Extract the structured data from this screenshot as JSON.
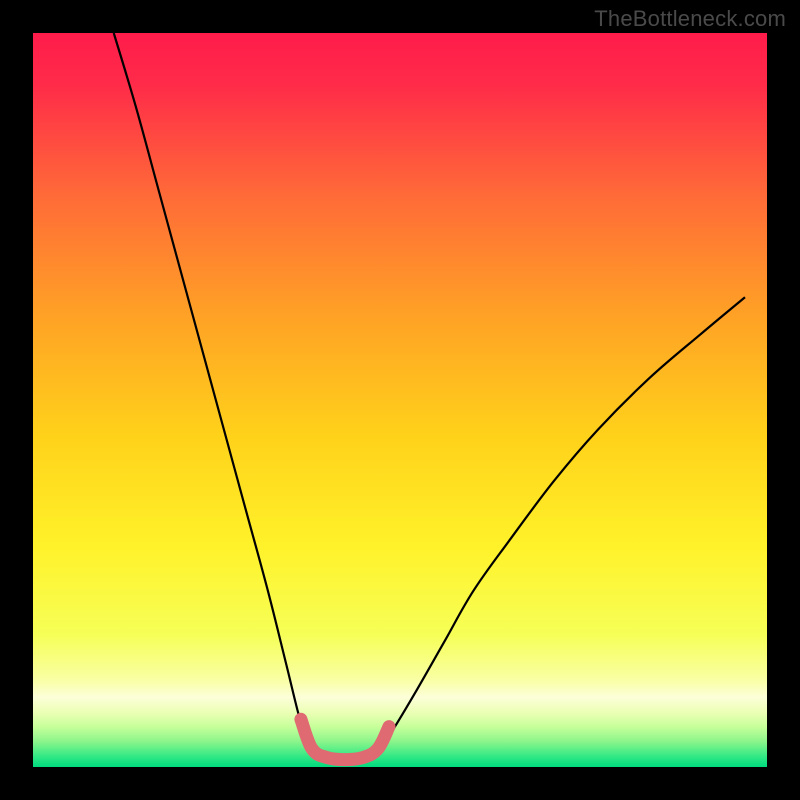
{
  "watermark": "TheBottleneck.com",
  "chart_data": {
    "type": "line",
    "title": "",
    "xlabel": "",
    "ylabel": "",
    "xlim": [
      0,
      100
    ],
    "ylim": [
      0,
      100
    ],
    "grid": false,
    "legend": false,
    "annotations": [],
    "background_gradient": {
      "top": "#ff1c4b",
      "mid_upper": "#ff8a2a",
      "mid": "#ffe600",
      "mid_lower": "#f7ff66",
      "near_bottom": "#d4ff8a",
      "bottom": "#00e37a"
    },
    "series": [
      {
        "name": "left-arm",
        "stroke": "#000000",
        "stroke_width": 2.2,
        "x": [
          11,
          14,
          17,
          20,
          23,
          26,
          29,
          32,
          34.5,
          36.5,
          38
        ],
        "y": [
          100,
          90,
          79,
          68,
          57,
          46,
          35,
          24,
          14,
          6,
          2
        ]
      },
      {
        "name": "right-arm",
        "stroke": "#000000",
        "stroke_width": 2.2,
        "x": [
          47,
          49,
          52,
          56,
          60,
          65,
          71,
          77,
          84,
          91,
          97
        ],
        "y": [
          2,
          5,
          10,
          17,
          24,
          31,
          39,
          46,
          53,
          59,
          64
        ]
      },
      {
        "name": "valley-highlight",
        "stroke": "#e06a72",
        "stroke_width": 13,
        "linecap": "round",
        "x": [
          36.5,
          38,
          40,
          42.5,
          45,
          47,
          48.5
        ],
        "y": [
          6.5,
          2.5,
          1.3,
          1.0,
          1.3,
          2.5,
          5.5
        ]
      }
    ]
  }
}
